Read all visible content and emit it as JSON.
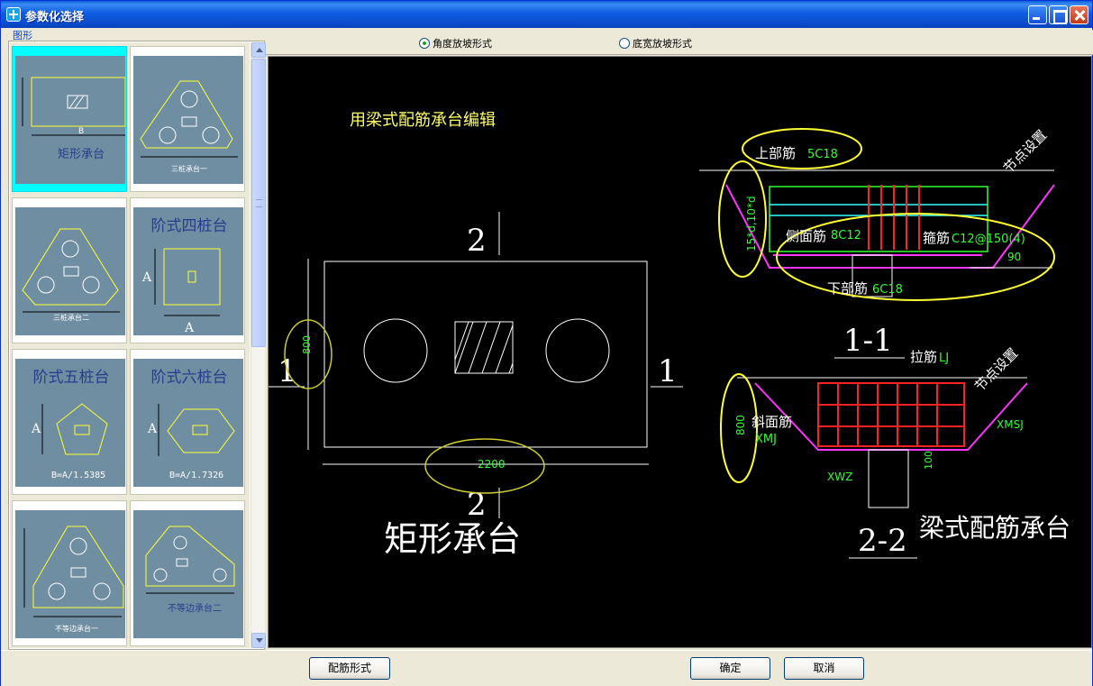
{
  "window": {
    "title": "参数化选择",
    "controls": [
      "minimize-icon",
      "maximize-icon",
      "close-icon"
    ]
  },
  "left": {
    "group_label": "图形",
    "thumbnails": [
      {
        "label": "矩形承台",
        "sub": "B",
        "selected": true
      },
      {
        "label": "三桩承台一",
        "sub": ""
      },
      {
        "label": "三桩承台二",
        "sub": ""
      },
      {
        "label": "阶式四桩台",
        "sub": "A"
      },
      {
        "label": "阶式五桩台",
        "sub": "B=A/1.5385"
      },
      {
        "label": "阶式六桩台",
        "sub": "B=A/1.7326"
      },
      {
        "label": "不等边承台一",
        "sub": ""
      },
      {
        "label": "不等边承台二",
        "sub": ""
      }
    ]
  },
  "options": {
    "radio1": "角度放坡形式",
    "radio2": "底宽放坡形式",
    "selected": "radio1"
  },
  "drawing": {
    "heading": "用梁式配筋承台编辑",
    "section_2_top": "2",
    "section_2_bottom": "2",
    "section_1_left": "1",
    "section_1_right": "1",
    "dim_height": "800",
    "dim_width": "2200",
    "caption_left": "矩形承台",
    "caption_right": "梁式配筋承台",
    "top_bar_label": "上部筋",
    "top_bar_value": "5C18",
    "side_bar_label": "侧面筋",
    "side_bar_value": "8C12",
    "stirrup_label": "箍筋",
    "stirrup_value": "C12@150(4)",
    "bottom_bar_label": "下部筋",
    "bottom_bar_value": "6C18",
    "angle_value": "90",
    "anchor_label": "15*d,10*d",
    "node_setting_1": "节点设置",
    "section_1_1": "1-1",
    "tie_label": "拉筋",
    "tie_value": "LJ",
    "slope_label": "斜面筋",
    "slope_value": "XMJ",
    "dim_800_section": "800",
    "xwz": "XWZ",
    "xmsj": "XMSJ",
    "dim_100": "100",
    "node_setting_2": "节点设置",
    "section_2_2": "2-2"
  },
  "buttons": {
    "rebar_form": "配筋形式",
    "ok": "确定",
    "cancel": "取消"
  }
}
